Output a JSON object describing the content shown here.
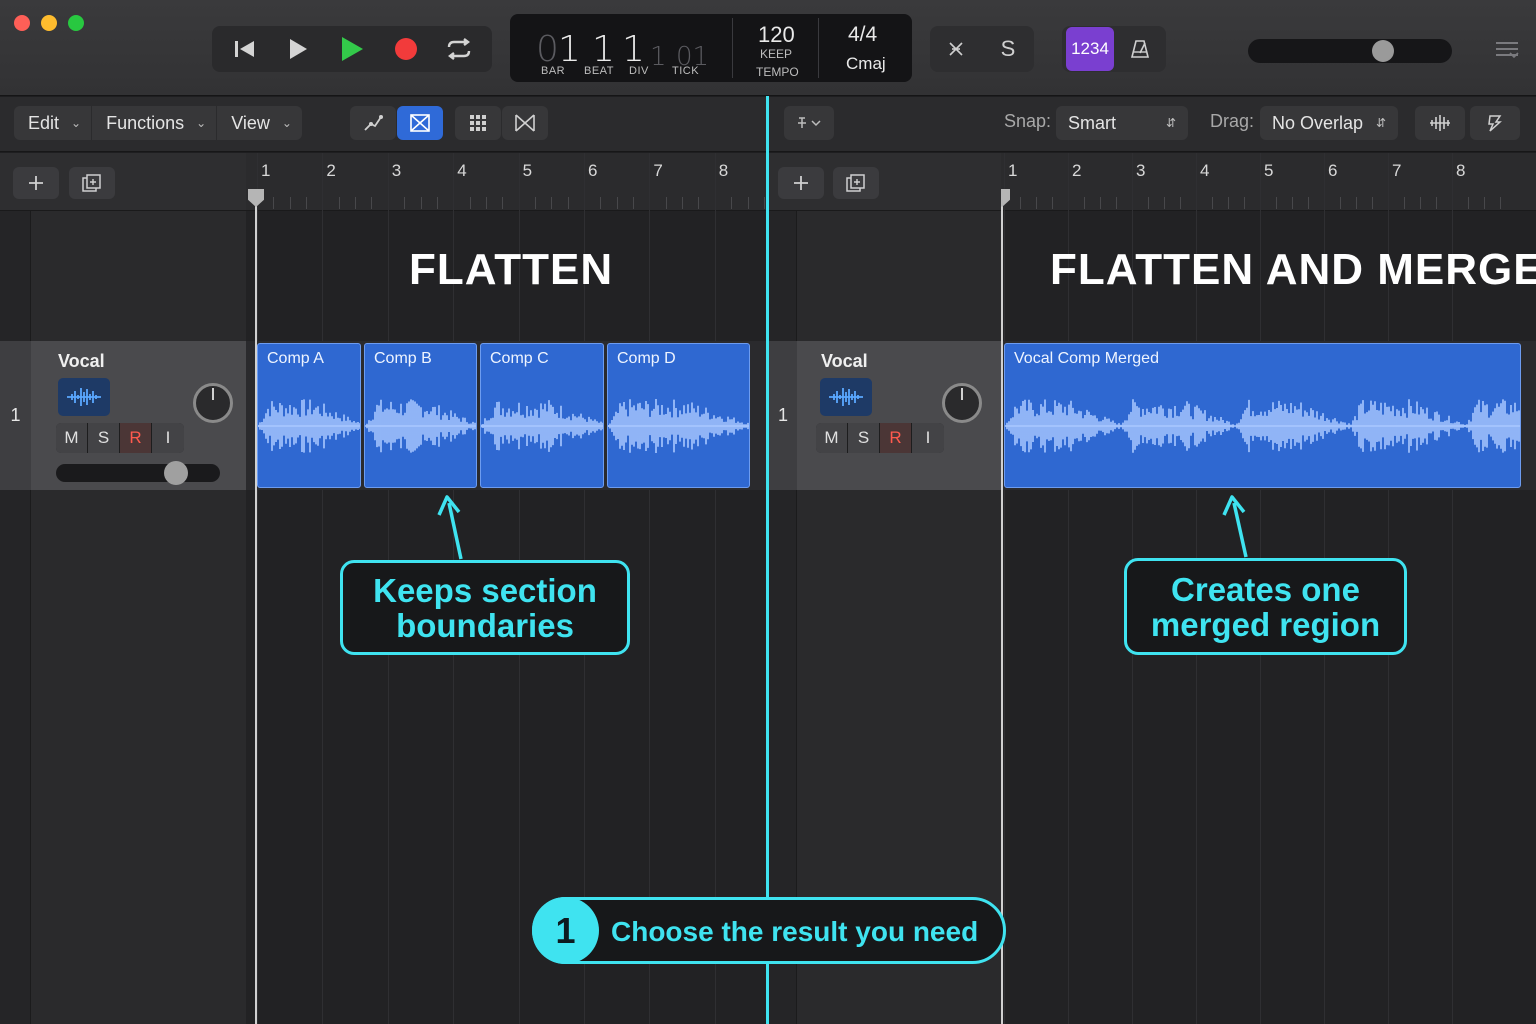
{
  "colors": {
    "accent_cyan": "#3fe3f0",
    "region_blue": "#2f68d1",
    "count_in_purple": "#7a3fd0",
    "record_red": "#f23b3b",
    "play_green": "#33c94a"
  },
  "transport": {
    "buttons": [
      "go-to-beginning-icon",
      "play-icon",
      "play-green-icon",
      "record-icon",
      "cycle-icon"
    ]
  },
  "lcd": {
    "bar": "1",
    "bar_leading": "0",
    "beat": "1",
    "div": "1",
    "tick_lead": "1",
    "tick": "01",
    "labels": {
      "bar": "BAR",
      "beat": "BEAT",
      "div": "DIV",
      "tick": "TICK"
    },
    "tempo": "120",
    "tempo_mode_1": "KEEP",
    "tempo_mode_2": "TEMPO",
    "time_signature": "4/4",
    "key": "Cmaj"
  },
  "controls": {
    "tuner_icon": "tuner-icon",
    "solo_label": "S",
    "count_in": "1234",
    "metronome_icon": "metronome-icon",
    "master_volume_level": 0.62
  },
  "toolbar": {
    "menus": [
      "Edit",
      "Functions",
      "View"
    ],
    "snap_label": "Snap:",
    "snap_value": "Smart",
    "drag_label": "Drag:",
    "drag_value": "No Overlap"
  },
  "left_panel": {
    "title": "FLATTEN",
    "bars": [
      "1",
      "2",
      "3",
      "4",
      "5",
      "6",
      "7",
      "8"
    ],
    "track": {
      "number": "1",
      "name": "Vocal",
      "buttons": [
        "M",
        "S",
        "R",
        "I"
      ],
      "volume_level": 0.66
    },
    "regions": [
      "Comp A",
      "Comp B",
      "Comp C",
      "Comp D"
    ],
    "callout_line1": "Keeps section",
    "callout_line2": "boundaries"
  },
  "right_panel": {
    "title": "FLATTEN AND MERGE",
    "bars": [
      "1",
      "2",
      "3",
      "4",
      "5",
      "6",
      "7",
      "8"
    ],
    "track": {
      "number": "1",
      "name": "Vocal",
      "buttons": [
        "M",
        "S",
        "R",
        "I"
      ]
    },
    "regions": [
      "Vocal Comp Merged"
    ],
    "callout_line1": "Creates one",
    "callout_line2": "merged region"
  },
  "step": {
    "number": "1",
    "text": "Choose the result you need"
  }
}
